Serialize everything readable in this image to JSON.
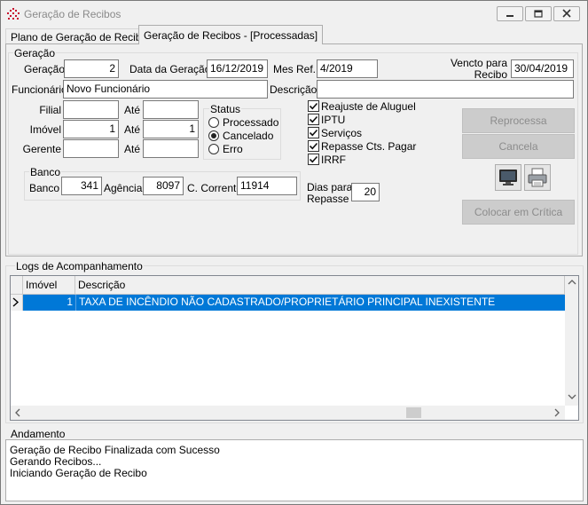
{
  "window": {
    "title": "Geração de Recibos",
    "controls": [
      "minimize",
      "restore",
      "close"
    ]
  },
  "tabs": [
    {
      "label": "Plano de Geração de Recibos",
      "active": false
    },
    {
      "label": "Geração de Recibos - [Processadas]",
      "active": true
    }
  ],
  "geracao": {
    "group_label": "Geração",
    "geracao_label": "Geração",
    "geracao_value": "2",
    "data_label": "Data da Geração",
    "data_value": "16/12/2019",
    "mes_label": "Mes Ref.",
    "mes_value": "4/2019",
    "vencto_label_1": "Vencto para",
    "vencto_label_2": "Recibo",
    "vencto_value": "30/04/2019",
    "funcionario_label": "Funcionário",
    "funcionario_value": "Novo Funcionário",
    "descricao_label": "Descrição",
    "descricao_value": ""
  },
  "filters": {
    "filial_label": "Filial",
    "filial_from": "",
    "filial_ate_label": "Até",
    "filial_to": "",
    "imovel_label": "Imóvel",
    "imovel_from": "1",
    "imovel_ate_label": "Até",
    "imovel_to": "1",
    "gerente_label": "Gerente",
    "gerente_from": "",
    "gerente_ate_label": "Até",
    "gerente_to": ""
  },
  "status": {
    "group_label": "Status",
    "options": [
      {
        "label": "Processado",
        "selected": false
      },
      {
        "label": "Cancelado",
        "selected": true
      },
      {
        "label": "Erro",
        "selected": false
      }
    ]
  },
  "checks": [
    {
      "label": "Reajuste de Aluguel",
      "checked": true
    },
    {
      "label": "IPTU",
      "checked": true
    },
    {
      "label": "Serviços",
      "checked": true
    },
    {
      "label": "Repasse Cts. Pagar",
      "checked": true
    },
    {
      "label": "IRRF",
      "checked": true
    }
  ],
  "banco": {
    "group_label": "Banco",
    "banco_label": "Banco",
    "banco_value": "341",
    "agencia_label": "Agência",
    "agencia_value": "8097",
    "conta_label": "C. Corrente",
    "conta_value": "11914"
  },
  "dias": {
    "label_1": "Dias para",
    "label_2": "Repasse",
    "value": "20"
  },
  "actions": {
    "reprocessa": "Reprocessa",
    "cancela": "Cancela",
    "critica": "Colocar em Crítica",
    "monitor_icon": "monitor-icon",
    "printer_icon": "printer-icon"
  },
  "logs": {
    "group_label": "Logs de Acompanhamento",
    "columns": [
      "Imóvel",
      "Descrição"
    ],
    "rows": [
      {
        "imovel": "1",
        "descricao": "TAXA DE INCÊNDIO NÃO CADASTRADO/PROPRIETÁRIO PRINCIPAL INEXISTENTE",
        "selected": true
      }
    ]
  },
  "andamento": {
    "group_label": "Andamento",
    "lines": [
      "Geração de Recibo Finalizada com Sucesso",
      "Gerando Recibos...",
      "Iniciando Geração de Recibo"
    ]
  },
  "colors": {
    "selection": "#0078d7",
    "window_bg": "#f0f0f0",
    "disabled_button": "#cccccc"
  }
}
